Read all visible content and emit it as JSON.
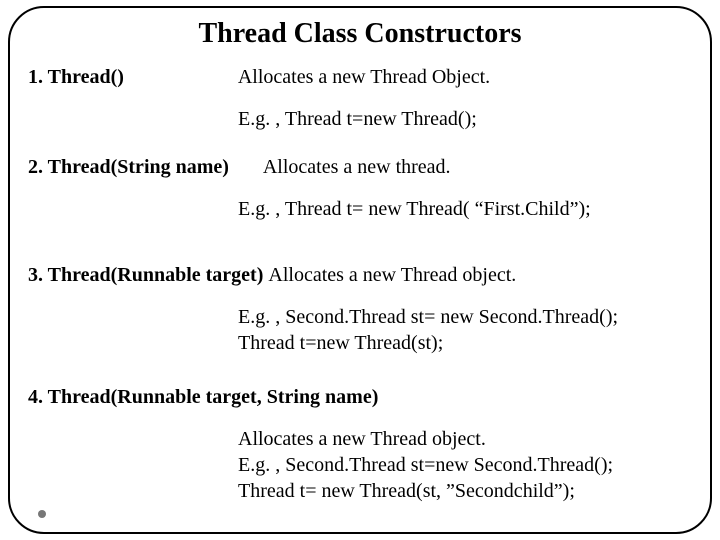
{
  "title": "Thread Class Constructors",
  "items": [
    {
      "sig": "1. Thread()",
      "gap": "                       ",
      "desc": "Allocates a new Thread Object.",
      "lines": [
        "E.g. , Thread t=new Thread();"
      ]
    },
    {
      "sig": "2. Thread(String name)",
      "gap": "       ",
      "desc": "Allocates a new thread.",
      "lines": [
        "E.g. , Thread t= new Thread( “First.Child”);"
      ]
    },
    {
      "sig": "3. Thread(Runnable target) ",
      "gap": "",
      "desc": "Allocates a new Thread object.",
      "lines": [
        "E.g. , Second.Thread st= new Second.Thread();",
        "Thread t=new Thread(st);"
      ]
    },
    {
      "sig": "4. Thread(Runnable target, String name)",
      "gap": "",
      "desc": "",
      "lines": [
        "Allocates a new Thread object.",
        "E.g. , Second.Thread st=new Second.Thread();",
        "Thread t= new Thread(st, ”Secondchild”);"
      ]
    }
  ]
}
